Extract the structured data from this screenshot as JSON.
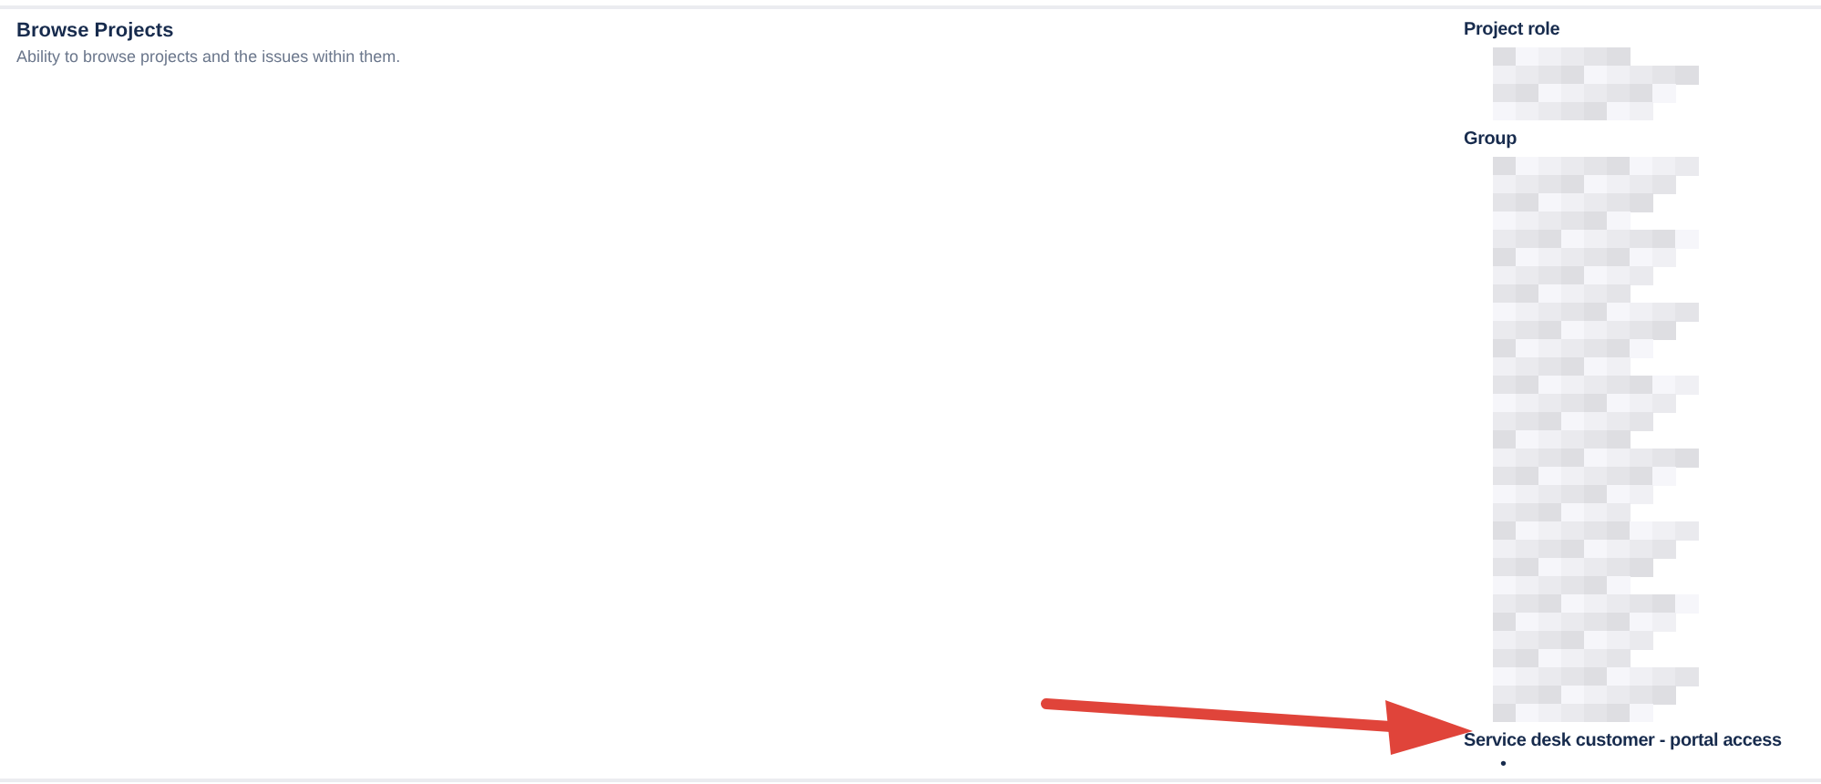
{
  "permission": {
    "title": "Browse Projects",
    "description": "Ability to browse projects and the issues within them."
  },
  "grants": [
    {
      "heading": "Project role",
      "kind": "redacted"
    },
    {
      "heading": "Group",
      "kind": "redacted"
    },
    {
      "heading": "Service desk customer - portal access",
      "kind": "list",
      "bullet": "•"
    }
  ]
}
